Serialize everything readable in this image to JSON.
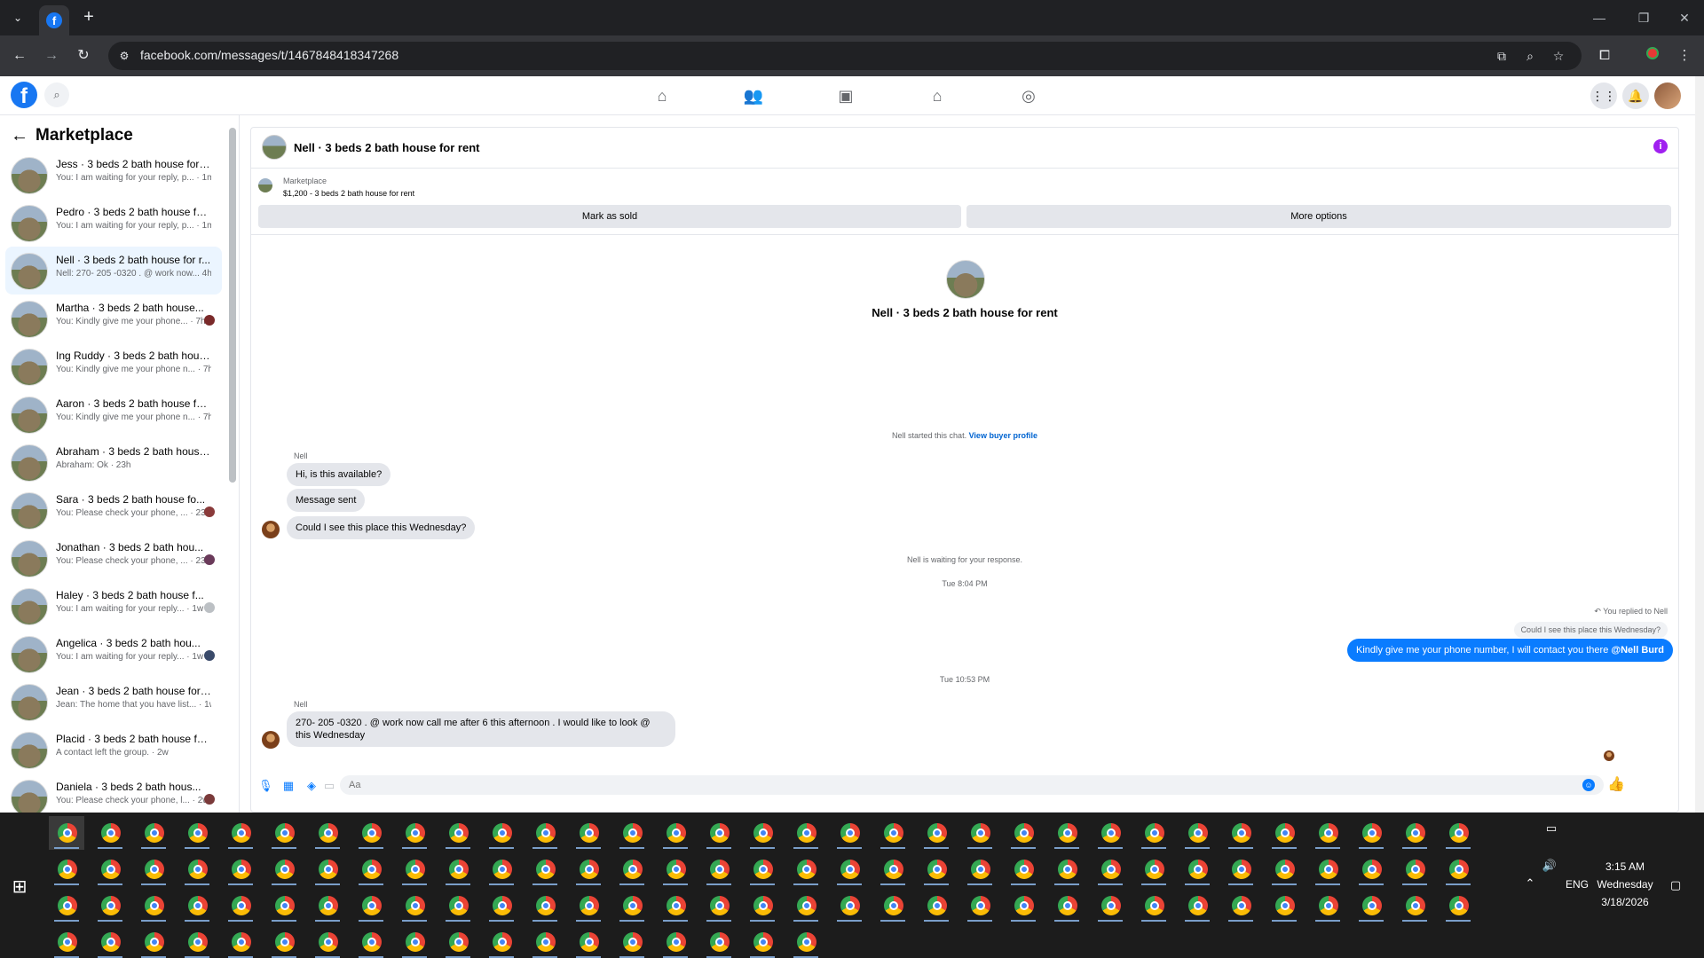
{
  "browser": {
    "url": "facebook.com/messages/t/1467848418347268",
    "tab_favicon": "f"
  },
  "fb": {
    "logo": "f"
  },
  "sidebar": {
    "title": "Marketplace",
    "conversations": [
      {
        "title": "Jess · 3 beds 2 bath house for r...",
        "preview": "You: I am waiting for your reply, p... · 1m",
        "dot": ""
      },
      {
        "title": "Pedro · 3 beds 2 bath house for...",
        "preview": "You: I am waiting for your reply, p... · 1m",
        "dot": ""
      },
      {
        "title": "Nell · 3 beds 2 bath house for r...",
        "preview": "Nell: 270- 205 -0320 . @ work now... 4h",
        "dot": ""
      },
      {
        "title": "Martha · 3 beds 2 bath house...",
        "preview": "You: Kindly give me your phone... · 7h",
        "dot": "#7a2a2a"
      },
      {
        "title": "Ing Ruddy · 3 beds 2 bath hous...",
        "preview": "You: Kindly give me your phone n... · 7h",
        "dot": ""
      },
      {
        "title": "Aaron · 3 beds 2 bath house for...",
        "preview": "You: Kindly give me your phone n... · 7h",
        "dot": ""
      },
      {
        "title": "Abraham · 3 beds 2 bath house ...",
        "preview": "Abraham: Ok · 23h",
        "dot": ""
      },
      {
        "title": "Sara · 3 beds 2 bath house fo...",
        "preview": "You: Please check your phone, ... · 23h",
        "dot": "#8a3a3a"
      },
      {
        "title": "Jonathan · 3 beds 2 bath hou...",
        "preview": "You: Please check your phone, ... · 23h",
        "dot": "#6a3a5a"
      },
      {
        "title": "Haley · 3 beds 2 bath house f...",
        "preview": "You: I am waiting for your reply... · 1w",
        "dot": "#bcc0c4"
      },
      {
        "title": "Angelica · 3 beds 2 bath hou...",
        "preview": "You: I am waiting for your reply... · 1w",
        "dot": "#3a4a6a"
      },
      {
        "title": "Jean · 3 beds 2 bath house for r...",
        "preview": "Jean: The home that you have list... · 1w",
        "dot": ""
      },
      {
        "title": "Placid · 3 beds 2 bath house for...",
        "preview": "A contact left the group. · 2w",
        "dot": ""
      },
      {
        "title": "Daniela · 3 beds 2 bath hous...",
        "preview": "You: Please check your phone, l... · 2w",
        "dot": "#7a3a3a"
      }
    ]
  },
  "chat": {
    "header_title": "Nell · 3 beds 2 bath house for rent",
    "info_icon": "i",
    "listing_source": "Marketplace",
    "listing_price_title": "$1,200 - 3 beds 2 bath house for rent",
    "mark_sold": "Mark as sold",
    "more_options": "More options",
    "hero_title": "Nell · 3 beds 2 bath house for rent",
    "started_text": "Nell started this chat.",
    "view_profile": "View buyer profile",
    "sender1": "Nell",
    "msg1": "Hi, is this available?",
    "msg2": "Message sent",
    "msg3": "Could I see this place this Wednesday?",
    "waiting": "Nell is waiting for your response.",
    "time1": "Tue 8:04 PM",
    "replied_to": "You replied to Nell",
    "quoted": "Could I see this place this Wednesday?",
    "out_msg": "Kindly give me your phone number, I will contact you there ",
    "out_mention": "@Nell Burd",
    "time2": "Tue 10:53 PM",
    "sender2": "Nell",
    "msg4": "270- 205 -0320 . @ work now call me after 6 this afternoon . I would like to look @ this Wednesday",
    "composer_placeholder": "Aa"
  },
  "taskbar": {
    "lang": "ENG",
    "time": "3:15 AM",
    "day": "Wednesday",
    "date": "3/18/2026"
  }
}
